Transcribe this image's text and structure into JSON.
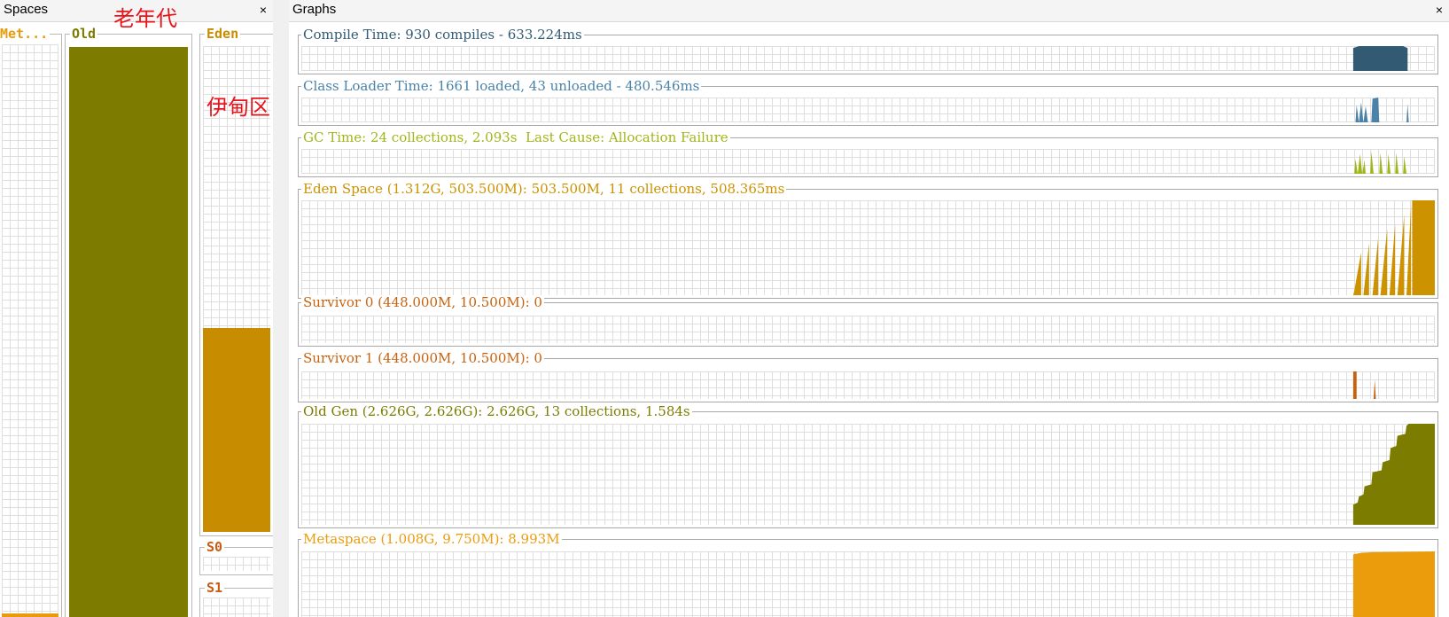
{
  "spaces_panel": {
    "title": "Spaces",
    "close": "×",
    "columns": {
      "metaspace": {
        "label": "Met...",
        "color": "#e89c0c",
        "fill_fraction": 0.01
      },
      "old": {
        "label": "Old",
        "color": "#7e7c00",
        "fill_fraction": 1.0
      },
      "eden": {
        "label": "Eden",
        "color": "#c88c00",
        "fill_fraction": 0.42
      },
      "s0": {
        "label": "S0",
        "color": "#c85c10",
        "fill_fraction": 0
      },
      "s1": {
        "label": "S1",
        "color": "#c85c10",
        "fill_fraction": 0
      }
    },
    "annotations": {
      "old_gen": "老年代",
      "eden": "伊甸区"
    }
  },
  "graphs_panel": {
    "title": "Graphs",
    "close": "×",
    "graphs": [
      {
        "key": "compile",
        "title": "Compile Time: 930 compiles - 633.224ms",
        "color": "#335a73"
      },
      {
        "key": "classloader",
        "title": "Class Loader Time: 1661 loaded, 43 unloaded - 480.546ms",
        "color": "#4a82a8"
      },
      {
        "key": "gc",
        "title": "GC Time: 24 collections, 2.093s  Last Cause: Allocation Failure",
        "color": "#a2b61a"
      },
      {
        "key": "eden",
        "title": "Eden Space (1.312G, 503.500M): 503.500M, 11 collections, 508.365ms",
        "color": "#cc9200"
      },
      {
        "key": "s0",
        "title": "Survivor 0 (448.000M, 10.500M): 0",
        "color": "#c8620e"
      },
      {
        "key": "s1",
        "title": "Survivor 1 (448.000M, 10.500M): 0",
        "color": "#c8620e"
      },
      {
        "key": "oldgen",
        "title": "Old Gen (2.626G, 2.626G): 2.626G, 13 collections, 1.584s",
        "color": "#7c7c00"
      },
      {
        "key": "metaspace",
        "title": "Metaspace (1.008G, 9.750M): 8.993M",
        "color": "#ea9c0c"
      }
    ]
  }
}
